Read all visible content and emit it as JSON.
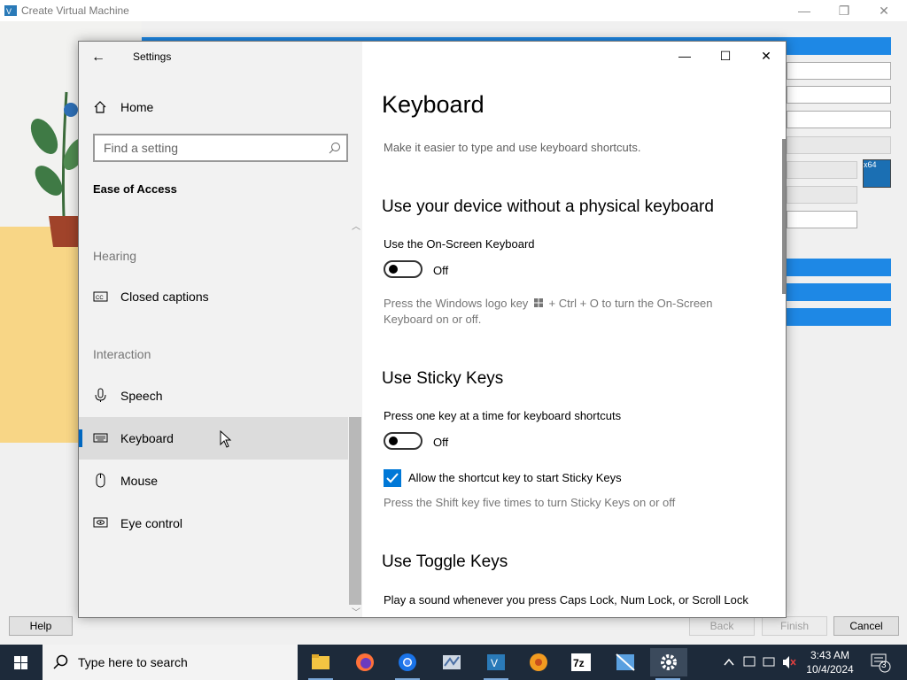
{
  "background_window": {
    "title": "Create Virtual Machine",
    "buttons": {
      "help": "Help",
      "back": "Back",
      "finish": "Finish",
      "cancel": "Cancel"
    },
    "badge_text": "x64"
  },
  "settings": {
    "window_title": "Settings",
    "nav": {
      "home": "Home",
      "search_placeholder": "Find a setting",
      "section": "Ease of Access",
      "groups": {
        "hearing": "Hearing",
        "interaction": "Interaction"
      },
      "items": [
        {
          "label": "Closed captions",
          "icon": "closed-captions-icon"
        },
        {
          "label": "Speech",
          "icon": "microphone-icon"
        },
        {
          "label": "Keyboard",
          "icon": "keyboard-icon",
          "selected": true
        },
        {
          "label": "Mouse",
          "icon": "mouse-icon"
        },
        {
          "label": "Eye control",
          "icon": "eye-control-icon"
        }
      ]
    },
    "page": {
      "title": "Keyboard",
      "description": "Make it easier to type and use keyboard shortcuts.",
      "sections": [
        {
          "heading": "Use your device without a physical keyboard",
          "setting_label": "Use the On-Screen Keyboard",
          "toggle_state": "Off",
          "hint_before": "Press the Windows logo key",
          "hint_after": "+ Ctrl + O to turn the On-Screen Keyboard on or off."
        },
        {
          "heading": "Use Sticky Keys",
          "setting_label": "Press one key at a time for keyboard shortcuts",
          "toggle_state": "Off",
          "checkbox_label": "Allow the shortcut key to start Sticky Keys",
          "checkbox_checked": true,
          "hint": "Press the Shift key five times to turn Sticky Keys on or off"
        },
        {
          "heading": "Use Toggle Keys",
          "setting_label": "Play a sound whenever you press Caps Lock, Num Lock, or Scroll Lock"
        }
      ]
    }
  },
  "taskbar": {
    "search_placeholder": "Type here to search",
    "time": "3:43 AM",
    "date": "10/4/2024",
    "notification_count": "3"
  },
  "colors": {
    "accent": "#0078d7",
    "taskbar": "#1d2a3a",
    "wizard_blue": "#1e88e5"
  }
}
